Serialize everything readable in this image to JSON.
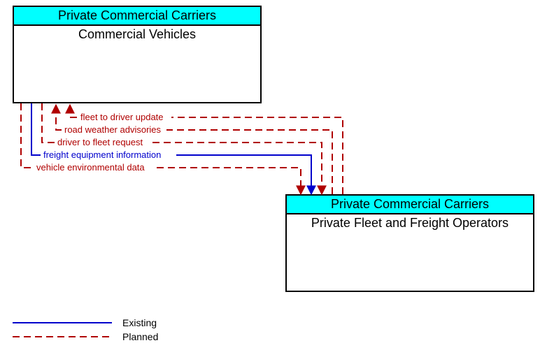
{
  "box_top": {
    "header": "Private Commercial Carriers",
    "body": "Commercial Vehicles"
  },
  "box_bottom": {
    "header": "Private Commercial Carriers",
    "body": "Private Fleet and Freight Operators"
  },
  "flows": {
    "f1": "fleet to driver update",
    "f2": "road weather advisories",
    "f3": "driver to fleet request",
    "f4": "freight equipment information",
    "f5": "vehicle environmental data"
  },
  "legend": {
    "existing": "Existing",
    "planned": "Planned"
  },
  "chart_data": {
    "type": "architecture-flow-diagram",
    "nodes": [
      {
        "id": "commercial_vehicles",
        "group": "Private Commercial Carriers",
        "label": "Commercial Vehicles"
      },
      {
        "id": "private_fleet_ops",
        "group": "Private Commercial Carriers",
        "label": "Private Fleet and Freight Operators"
      }
    ],
    "edges": [
      {
        "label": "fleet to driver update",
        "from": "private_fleet_ops",
        "to": "commercial_vehicles",
        "status": "Planned"
      },
      {
        "label": "road weather advisories",
        "from": "private_fleet_ops",
        "to": "commercial_vehicles",
        "status": "Planned"
      },
      {
        "label": "driver to fleet request",
        "from": "commercial_vehicles",
        "to": "private_fleet_ops",
        "status": "Planned"
      },
      {
        "label": "freight equipment information",
        "from": "commercial_vehicles",
        "to": "private_fleet_ops",
        "status": "Existing"
      },
      {
        "label": "vehicle environmental data",
        "from": "commercial_vehicles",
        "to": "private_fleet_ops",
        "status": "Planned"
      }
    ],
    "legend": {
      "Existing": {
        "color": "#0000cc",
        "style": "solid"
      },
      "Planned": {
        "color": "#b00000",
        "style": "dashed"
      }
    }
  }
}
